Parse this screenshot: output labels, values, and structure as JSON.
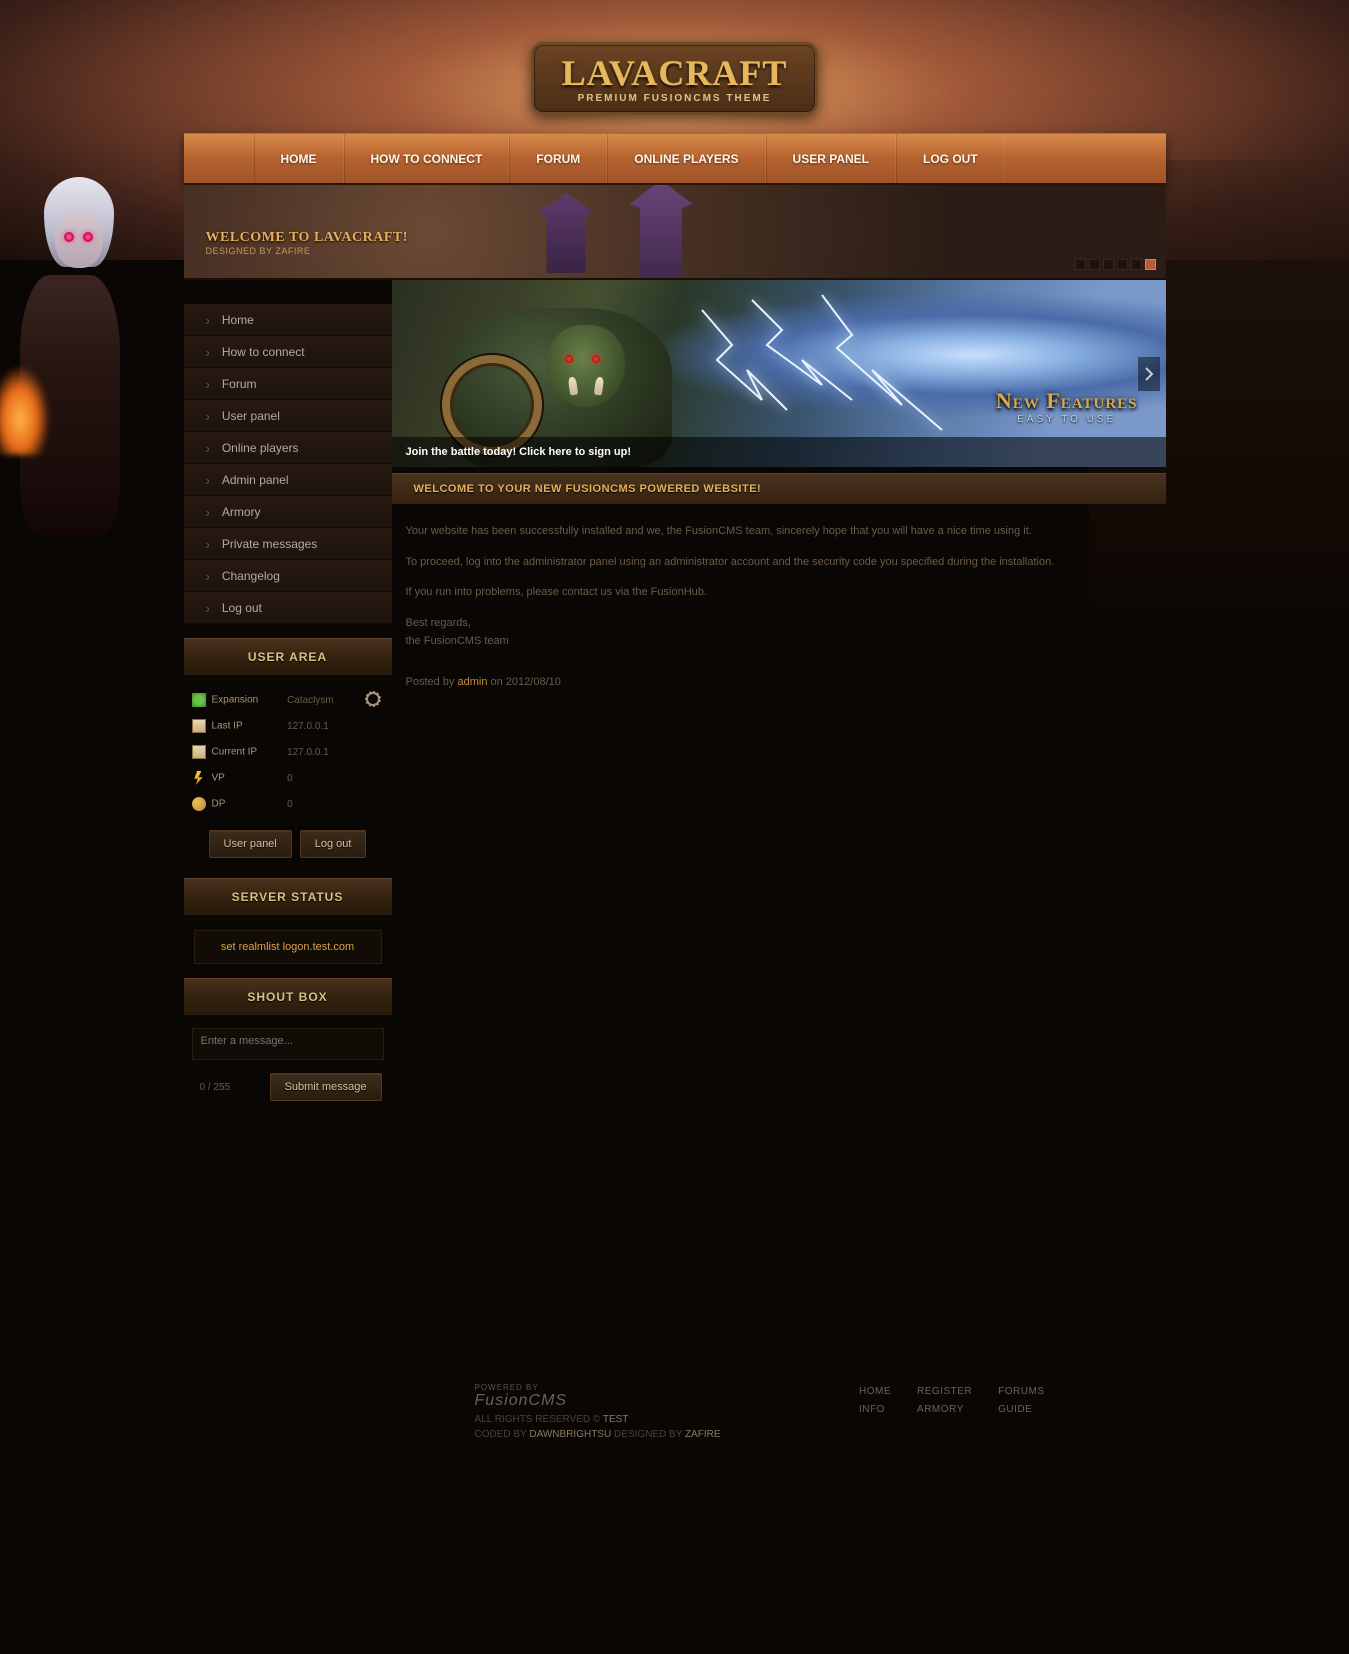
{
  "site": {
    "title": "LAVACRAFT",
    "subtitle": "PREMIUM FUSIONCMS THEME"
  },
  "topnav": {
    "items": [
      {
        "label": "HOME"
      },
      {
        "label": "HOW TO CONNECT"
      },
      {
        "label": "FORUM"
      },
      {
        "label": "ONLINE PLAYERS"
      },
      {
        "label": "USER PANEL"
      },
      {
        "label": "LOG OUT"
      }
    ]
  },
  "hero": {
    "title": "WELCOME TO LAVACRAFT!",
    "byline": "DESIGNED BY ZAFIRE"
  },
  "sidebar": {
    "menu": [
      {
        "label": "Home"
      },
      {
        "label": "How to connect"
      },
      {
        "label": "Forum"
      },
      {
        "label": "User panel"
      },
      {
        "label": "Online players"
      },
      {
        "label": "Admin panel"
      },
      {
        "label": "Armory"
      },
      {
        "label": "Private messages"
      },
      {
        "label": "Changelog"
      },
      {
        "label": "Log out"
      }
    ],
    "user_area": {
      "heading": "USER AREA",
      "rows": [
        {
          "icon": "puzzle",
          "label": "Expansion",
          "value": "Cataclysm"
        },
        {
          "icon": "note",
          "label": "Last IP",
          "value": "127.0.0.1"
        },
        {
          "icon": "note",
          "label": "Current IP",
          "value": "127.0.0.1"
        },
        {
          "icon": "bolt",
          "label": "VP",
          "value": "0"
        },
        {
          "icon": "coins",
          "label": "DP",
          "value": "0"
        }
      ],
      "btn_userpanel": "User panel",
      "btn_logout": "Log out"
    },
    "server_status": {
      "heading": "SERVER STATUS",
      "realmlist": "set realmlist logon.test.com"
    },
    "shoutbox": {
      "heading": "SHOUT BOX",
      "placeholder": "Enter a message...",
      "counter": "0 / 255",
      "submit": "Submit message"
    }
  },
  "feature": {
    "title": "New Features",
    "subtitle": "EASY TO USE",
    "cta": "Join the battle today! Click here to sign up!"
  },
  "article": {
    "heading": "WELCOME TO YOUR NEW FUSIONCMS POWERED WEBSITE!",
    "p1": "Your website has been successfully installed and we, the FusionCMS team, sincerely hope that you will have a nice time using it.",
    "p2": "To proceed, log into the administrator panel using an administrator account and the security code you specified during the installation.",
    "p3": "If you run into problems, please contact us via the FusionHub.",
    "p4": "Best regards,",
    "p5": "the FusionCMS team",
    "meta_pre": "Posted by ",
    "meta_author": "admin",
    "meta_post": " on 2012/08/10"
  },
  "footer": {
    "powered_lbl": "POWERED BY",
    "powered": "FusionCMS",
    "rights_pre": "ALL RIGHTS RESERVED © ",
    "rights_name": "TEST",
    "coded_pre": "CODED BY ",
    "coder": "DAWNBRIGHTSU",
    "design_pre": " DESIGNED BY ",
    "designer": "ZAFIRE",
    "links_col1": [
      {
        "label": "HOME"
      },
      {
        "label": "INFO"
      }
    ],
    "links_col2": [
      {
        "label": "REGISTER"
      },
      {
        "label": "ARMORY"
      }
    ],
    "links_col3": [
      {
        "label": "FORUMS"
      },
      {
        "label": "GUIDE"
      }
    ]
  }
}
